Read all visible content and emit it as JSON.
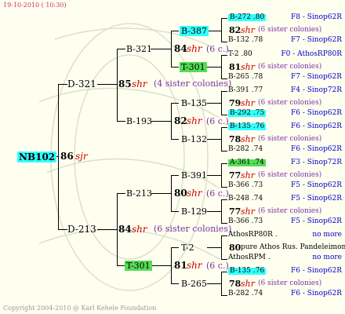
{
  "header": {
    "date": "19-10-2010 ( 10:30)"
  },
  "footer": {
    "copyright": "Copyright 2004-2010 @ Karl Kehele Foundation"
  },
  "root": {
    "id": "NB102",
    "num": "86",
    "tag": "sjr"
  },
  "g1": {
    "top": {
      "id": "D-321",
      "num": "85",
      "tag": "shr",
      "note": "(4 sister colonies)"
    },
    "bottom": {
      "id": "D-213",
      "num": "84",
      "tag": "shr",
      "note": "(6 sister colonies)"
    }
  },
  "g2": {
    "a": {
      "id": "B-321",
      "num": "84",
      "tag": "shr",
      "note": "(6 c.)"
    },
    "b": {
      "id": "B-193",
      "num": "82",
      "tag": "shr",
      "note": "(6 c.)"
    },
    "c": {
      "id": "B-213",
      "num": "80",
      "tag": "shr",
      "note": "(6 c.)"
    },
    "d": {
      "id": "T-301",
      "num": "81",
      "tag": "shr",
      "note": "(6 c.)"
    }
  },
  "g3": {
    "a1": {
      "id": "B-387",
      "num": "82",
      "tag": "shr",
      "note": "(6 sister colonies)"
    },
    "a2": {
      "id": "T-301",
      "num": "81",
      "tag": "shr",
      "note": "(6 sister colonies)"
    },
    "b1": {
      "id": "B-135",
      "num": "79",
      "tag": "shr",
      "note": "(6 sister colonies)"
    },
    "b2": {
      "id": "B-132",
      "num": "78",
      "tag": "shr",
      "note": "(6 sister colonies)"
    },
    "c1": {
      "id": "B-391",
      "num": "77",
      "tag": "shr",
      "note": "(6 sister colonies)"
    },
    "c2": {
      "id": "B-129",
      "num": "77",
      "tag": "shr",
      "note": "(6 sister colonies)"
    },
    "d1": {
      "id": "T-2",
      "num": "80",
      "line": "pure Athos Rus. Pandeleimonos"
    },
    "d2": {
      "id": "B-265",
      "num": "78",
      "tag": "shr",
      "note": "(6 sister colonies)"
    }
  },
  "g4": [
    {
      "id": "B-272 .80",
      "hl": "cyan",
      "loc": "F8 - Sinop62R"
    },
    {
      "id": "B-132 .78",
      "hl": "",
      "loc": "F7 - Sinop62R"
    },
    {
      "id": "T-2 .80",
      "hl": "",
      "loc": "F0 - AthosRP80R"
    },
    {
      "id": "B-265 .78",
      "hl": "",
      "loc": "F7 - Sinop62R"
    },
    {
      "id": "B-391 .77",
      "hl": "",
      "loc": "F4 - Sinop72R"
    },
    {
      "id": "B-292 .75",
      "hl": "cyan",
      "loc": "F6 - Sinop62R"
    },
    {
      "id": "B-135 .76",
      "hl": "cyan",
      "loc": "F6 - Sinop62R"
    },
    {
      "id": "B-282 .74",
      "hl": "",
      "loc": "F6 - Sinop62R"
    },
    {
      "id": "A-361 .74",
      "hl": "green",
      "loc": "F3 - Sinop72R"
    },
    {
      "id": "B-366 .73",
      "hl": "",
      "loc": "F5 - Sinop62R"
    },
    {
      "id": "B-248 .74",
      "hl": "",
      "loc": "F5 - Sinop62R"
    },
    {
      "id": "B-366 .73",
      "hl": "",
      "loc": "F5 - Sinop62R"
    },
    {
      "id": "AthosRP80R .",
      "hl": "",
      "loc": "no more"
    },
    {
      "id": "AthosRPM .",
      "hl": "",
      "loc": "no more"
    },
    {
      "id": "B-135 .76",
      "hl": "cyan",
      "loc": "F6 - Sinop62R"
    },
    {
      "id": "B-282 .74",
      "hl": "",
      "loc": "F6 - Sinop62R"
    }
  ]
}
